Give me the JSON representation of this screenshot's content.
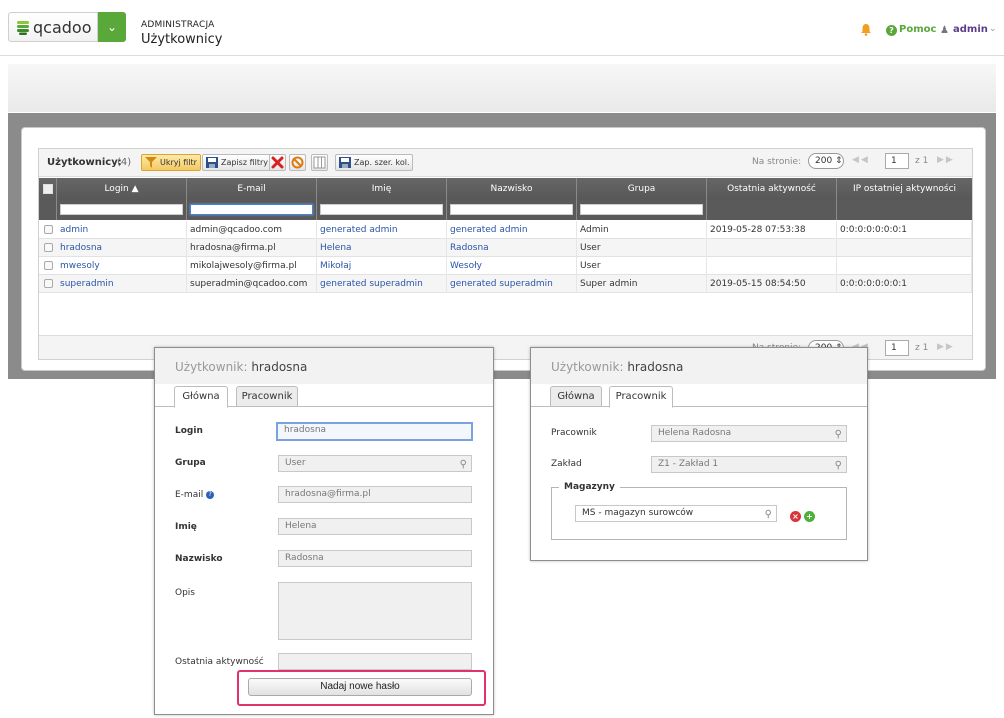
{
  "app": {
    "logo_text": "qcadoo"
  },
  "header": {
    "section": "ADMINISTRACJA",
    "title": "Użytkownicy",
    "help_label": "Pomoc",
    "user_label": "admin"
  },
  "grid": {
    "title": "Użytkownicy:",
    "count": "(4)",
    "toolbar": {
      "hide_filter": "Ukryj filtr",
      "save_filters": "Zapisz filtry",
      "save_widths": "Zap. szer. kol."
    },
    "pager": {
      "per_page_label": "Na stronie:",
      "per_page": "200",
      "page": "1",
      "of": "z 1"
    },
    "columns": [
      "Login",
      "E-mail",
      "Imię",
      "Nazwisko",
      "Grupa",
      "Ostatnia aktywność",
      "IP ostatniej aktywności"
    ],
    "sort_indicator": "▲",
    "rows": [
      {
        "login": "admin",
        "email": "admin@qcadoo.com",
        "imie": "generated admin",
        "nazwisko": "generated admin",
        "grupa": "Admin",
        "aktywnosc": "2019-05-28 07:53:38",
        "ip": "0:0:0:0:0:0:0:1"
      },
      {
        "login": "hradosna",
        "email": "hradosna@firma.pl",
        "imie": "Helena",
        "nazwisko": "Radosna",
        "grupa": "User",
        "aktywnosc": "",
        "ip": ""
      },
      {
        "login": "mwesoly",
        "email": "mikolajwesoly@firma.pl",
        "imie": "Mikołaj",
        "nazwisko": "Wesoły",
        "grupa": "User",
        "aktywnosc": "",
        "ip": ""
      },
      {
        "login": "superadmin",
        "email": "superadmin@qcadoo.com",
        "imie": "generated superadmin",
        "nazwisko": "generated superadmin",
        "grupa": "Super admin",
        "aktywnosc": "2019-05-15 08:54:50",
        "ip": "0:0:0:0:0:0:0:1"
      }
    ]
  },
  "form_main": {
    "title_prefix": "Użytkownik:",
    "title_value": "hradosna",
    "tabs": [
      "Główna",
      "Pracownik"
    ],
    "fields": {
      "login_label": "Login",
      "login_value": "hradosna",
      "grupa_label": "Grupa",
      "grupa_value": "User",
      "email_label": "E-mail",
      "email_value": "hradosna@firma.pl",
      "imie_label": "Imię",
      "imie_value": "Helena",
      "nazwisko_label": "Nazwisko",
      "nazwisko_value": "Radosna",
      "opis_label": "Opis",
      "aktywnosc_label": "Ostatnia aktywność"
    },
    "reset_password_button": "Nadaj nowe hasło"
  },
  "form_worker": {
    "title_prefix": "Użytkownik:",
    "title_value": "hradosna",
    "tabs": [
      "Główna",
      "Pracownik"
    ],
    "fields": {
      "pracownik_label": "Pracownik",
      "pracownik_value": "Helena Radosna",
      "zaklad_label": "Zakład",
      "zaklad_value": "Z1 - Zakład 1",
      "magazyny_legend": "Magazyny",
      "magazyn_value": "MS - magazyn surowców"
    }
  },
  "colors": {
    "accent_green": "#5aa83a",
    "link_blue": "#2a55a8",
    "highlight": "#e0336b"
  }
}
